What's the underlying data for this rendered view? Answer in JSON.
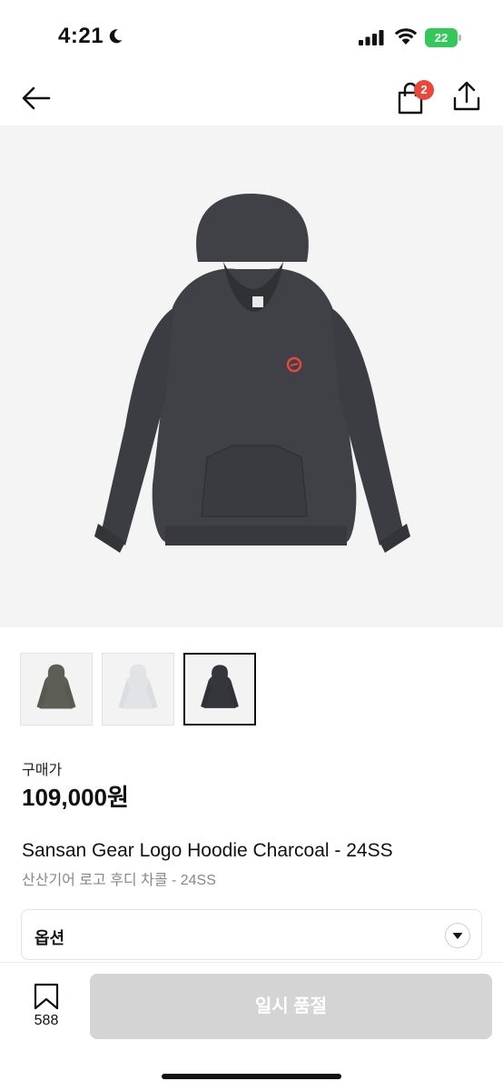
{
  "status": {
    "time": "4:21",
    "battery": "22"
  },
  "header": {
    "cart_count": "2"
  },
  "product": {
    "price_label": "구매가",
    "price": "109,000원",
    "name_en": "Sansan Gear Logo Hoodie Charcoal - 24SS",
    "name_ko": "산산기어 로고 후디 차콜 - 24SS",
    "thumbnails": [
      {
        "color": "#5d5f55"
      },
      {
        "color": "#e6e7ea"
      },
      {
        "color": "#34363b",
        "selected": true
      }
    ],
    "hoodie_color": "#3f4146",
    "logo_color": "#e8483c"
  },
  "option": {
    "label": "옵션"
  },
  "bottom": {
    "bookmark_count": "588",
    "action_label": "일시 품절"
  }
}
